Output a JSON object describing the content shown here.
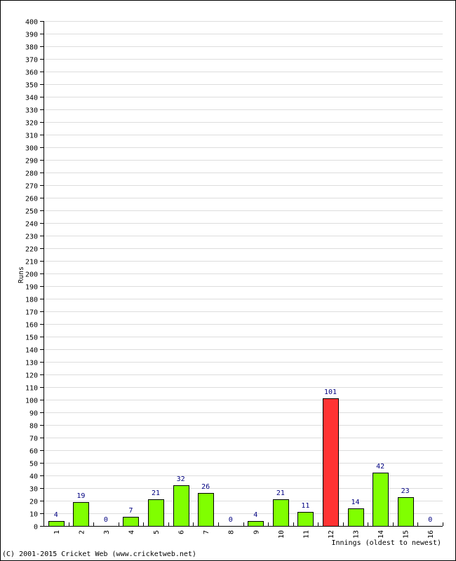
{
  "chart_data": {
    "type": "bar",
    "title": "",
    "xlabel": "Innings (oldest to newest)",
    "ylabel": "Runs",
    "ylim": [
      0,
      400
    ],
    "ytick_step": 10,
    "grid": true,
    "categories": [
      "1",
      "2",
      "3",
      "4",
      "5",
      "6",
      "7",
      "8",
      "9",
      "10",
      "11",
      "12",
      "13",
      "14",
      "15",
      "16"
    ],
    "values": [
      4,
      19,
      0,
      7,
      21,
      32,
      26,
      0,
      4,
      21,
      11,
      101,
      14,
      42,
      23,
      0
    ],
    "highlight_threshold": 100,
    "colors": {
      "bar": "#80ff00",
      "highlight": "#ff3333",
      "bar_border": "#000000",
      "value_label": "#000080",
      "grid": "#dddddd"
    }
  },
  "footer": {
    "copyright": "(C) 2001-2015 Cricket Web (www.cricketweb.net)"
  }
}
